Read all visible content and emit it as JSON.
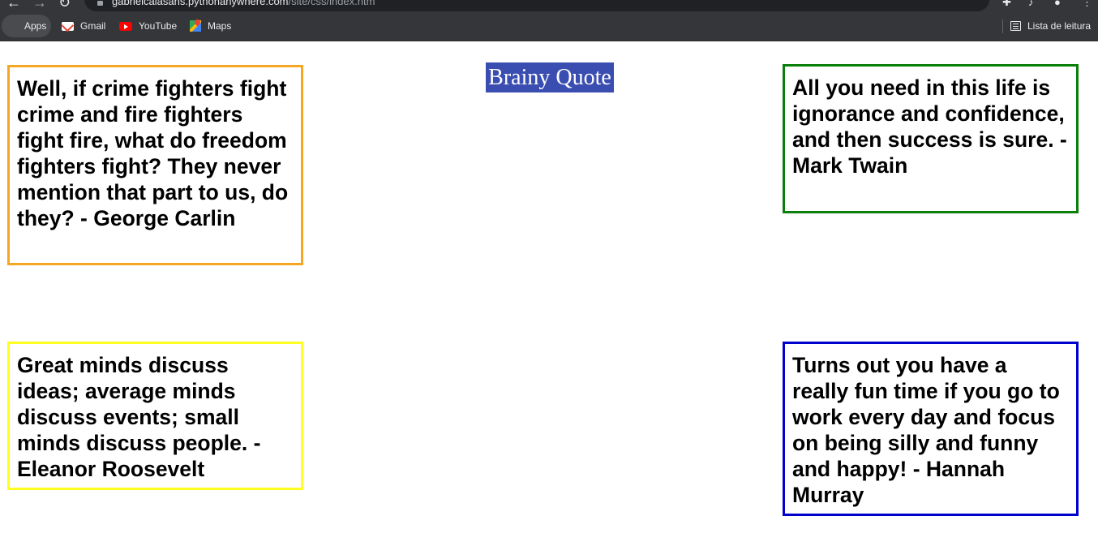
{
  "browser": {
    "url_host": "gabrielcalasans.pythonanywhere.com",
    "url_path": "/site/css/index.htm",
    "bookmarks": [
      {
        "label": "Apps",
        "icon": "apps-grid-icon"
      },
      {
        "label": "Gmail",
        "icon": "gmail-icon"
      },
      {
        "label": "YouTube",
        "icon": "youtube-icon"
      },
      {
        "label": "Maps",
        "icon": "maps-icon"
      }
    ],
    "reading_list_label": "Lista de leitura"
  },
  "page": {
    "title": "Brainy Quote",
    "quotes": [
      {
        "text": "Well, if crime fighters fight crime and fire fighters fight fire, what do freedom fighters fight? They never mention that part to us, do they? - George Carlin",
        "border_color": "#f5a623"
      },
      {
        "text": "All you need in this life is ignorance and confidence, and then success is sure. - Mark Twain",
        "border_color": "#0a7f0a"
      },
      {
        "text": "Great minds discuss ideas; average minds discuss events; small minds discuss people. - Eleanor Roosevelt",
        "border_color": "#ffff22"
      },
      {
        "text": "Turns out you have a really fun time if you go to work every day and focus on being silly and funny and happy! - Hannah Murray",
        "border_color": "#0000cc"
      }
    ],
    "title_background": "#3a4db0"
  }
}
